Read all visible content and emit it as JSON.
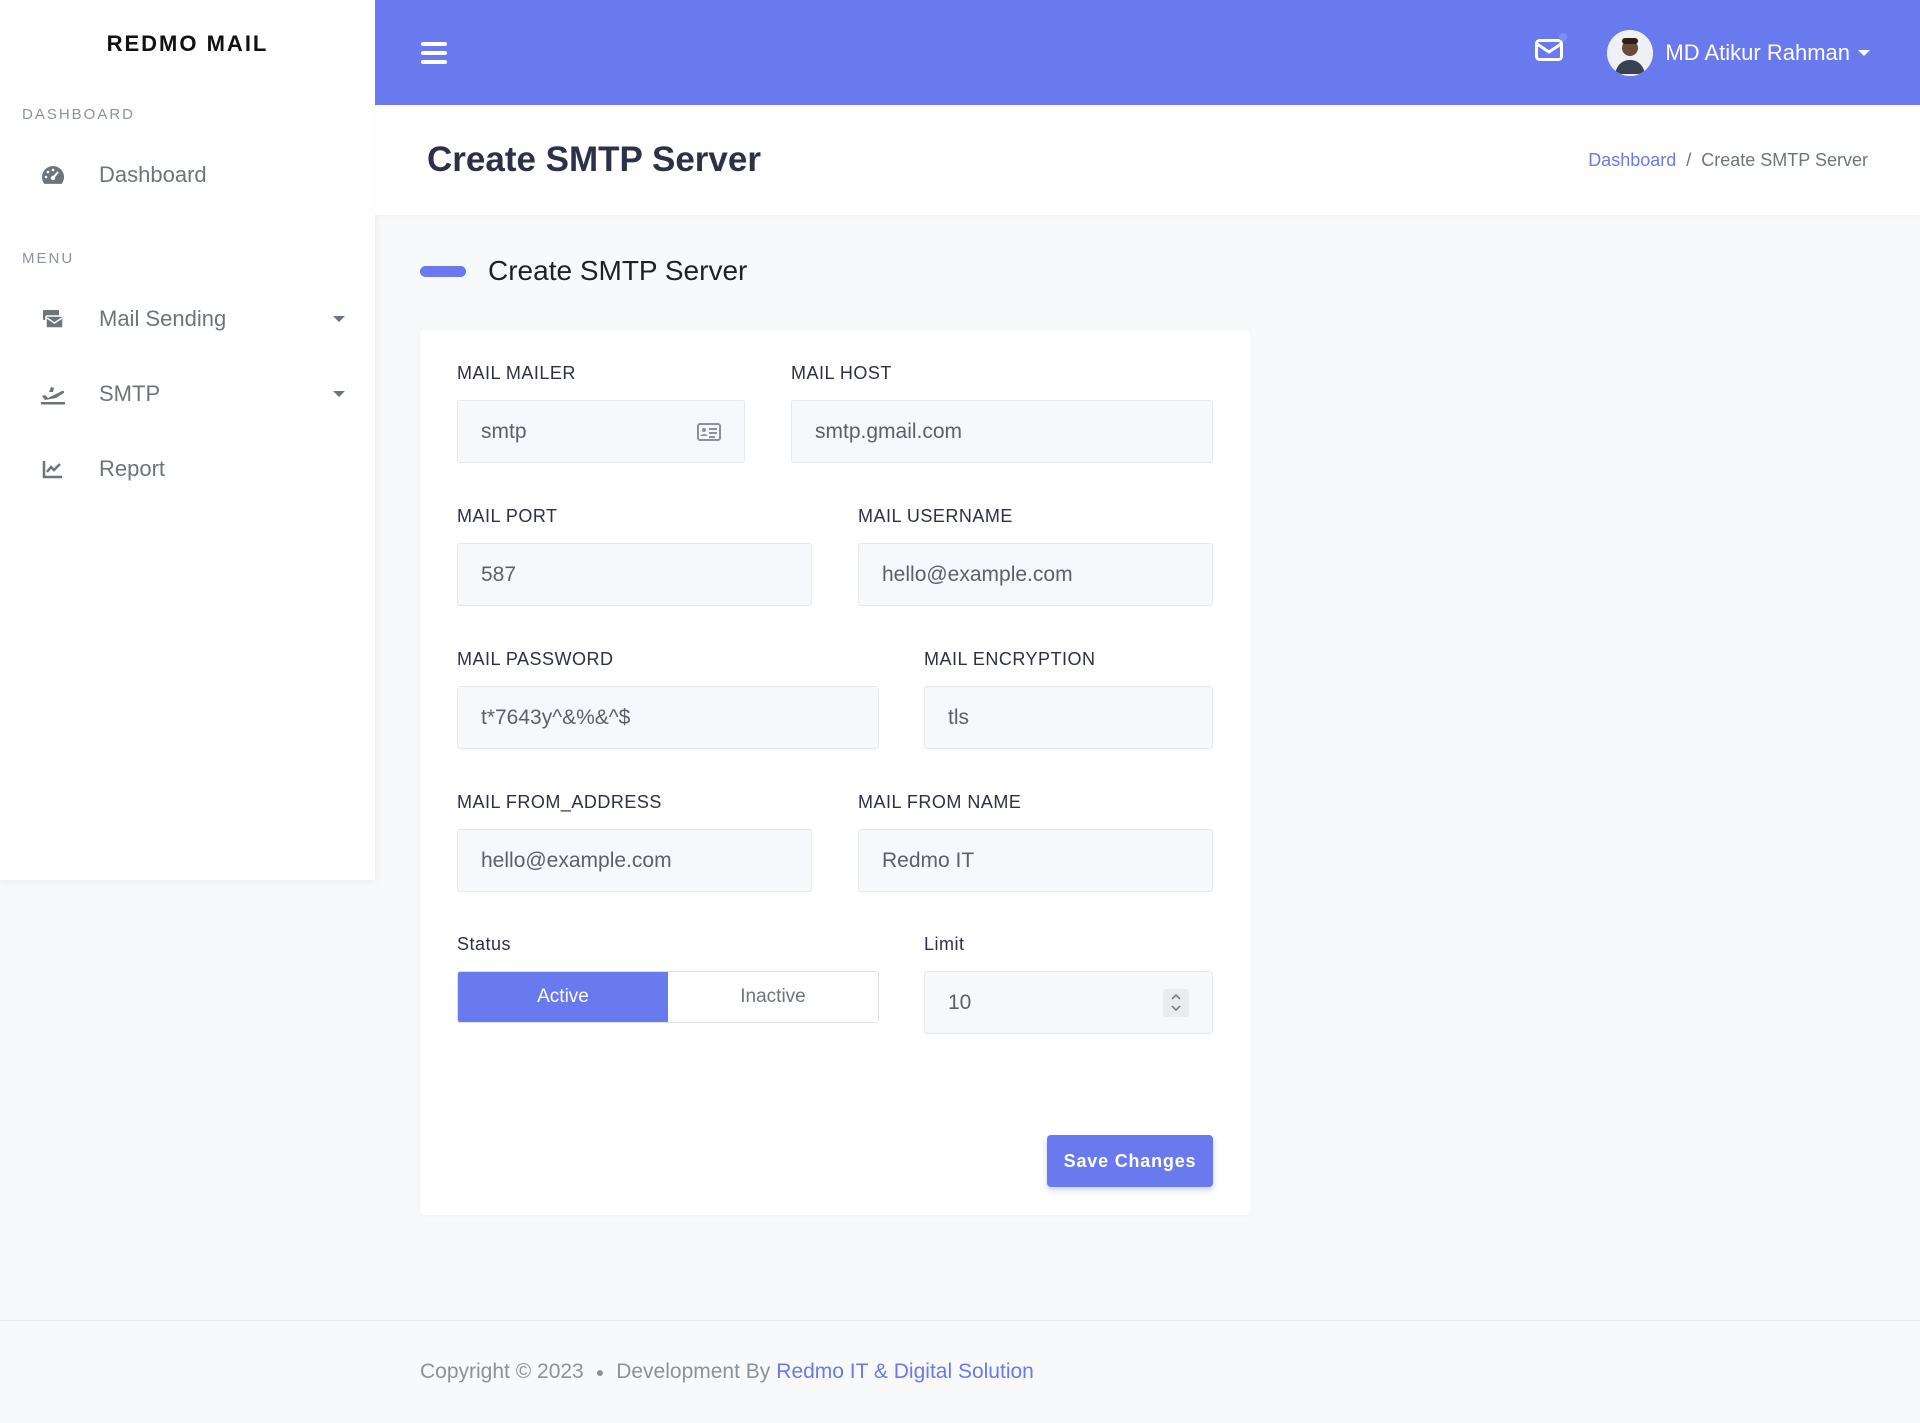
{
  "brand": {
    "name": "REDMO MAIL"
  },
  "sidebar": {
    "sections": [
      {
        "heading": "DASHBOARD"
      },
      {
        "heading": "MENU"
      }
    ],
    "items": [
      {
        "label": "Dashboard",
        "icon": "gauge-icon"
      },
      {
        "label": "Mail Sending",
        "icon": "mail-stack-icon",
        "expandable": true
      },
      {
        "label": "SMTP",
        "icon": "plane-departure-icon",
        "expandable": true
      },
      {
        "label": "Report",
        "icon": "chart-line-icon"
      }
    ]
  },
  "topbar": {
    "user_name": "MD Atikur Rahman"
  },
  "page": {
    "title": "Create SMTP Server",
    "breadcrumb": {
      "home": "Dashboard",
      "current": "Create SMTP Server"
    }
  },
  "form": {
    "section_title": "Create SMTP Server",
    "mail_mailer": {
      "label": "MAIL MAILER",
      "value": "smtp"
    },
    "mail_host": {
      "label": "MAIL HOST",
      "value": "smtp.gmail.com"
    },
    "mail_port": {
      "label": "MAIL PORT",
      "value": "587"
    },
    "mail_username": {
      "label": "MAIL USERNAME",
      "value": "hello@example.com"
    },
    "mail_password": {
      "label": "MAIL PASSWORD",
      "value": "t*7643y^&%&^$"
    },
    "mail_encryption": {
      "label": "MAIL ENCRYPTION",
      "value": "tls"
    },
    "mail_from_address": {
      "label": "MAIL FROM_ADDRESS",
      "value": "hello@example.com"
    },
    "mail_from_name": {
      "label": "MAIL FROM NAME",
      "value": "Redmo IT"
    },
    "status": {
      "label": "Status",
      "active": "Active",
      "inactive": "Inactive",
      "selected": "Active"
    },
    "limit": {
      "label": "Limit",
      "value": "10"
    },
    "save_label": "Save Changes"
  },
  "footer": {
    "copyright": "Copyright © 2023",
    "dev_by": "Development By",
    "company": "Redmo IT & Digital Solution"
  },
  "colors": {
    "accent": "#6979ee",
    "sidebar_bg": "#ffffff",
    "page_bg": "#f8f9fa"
  }
}
